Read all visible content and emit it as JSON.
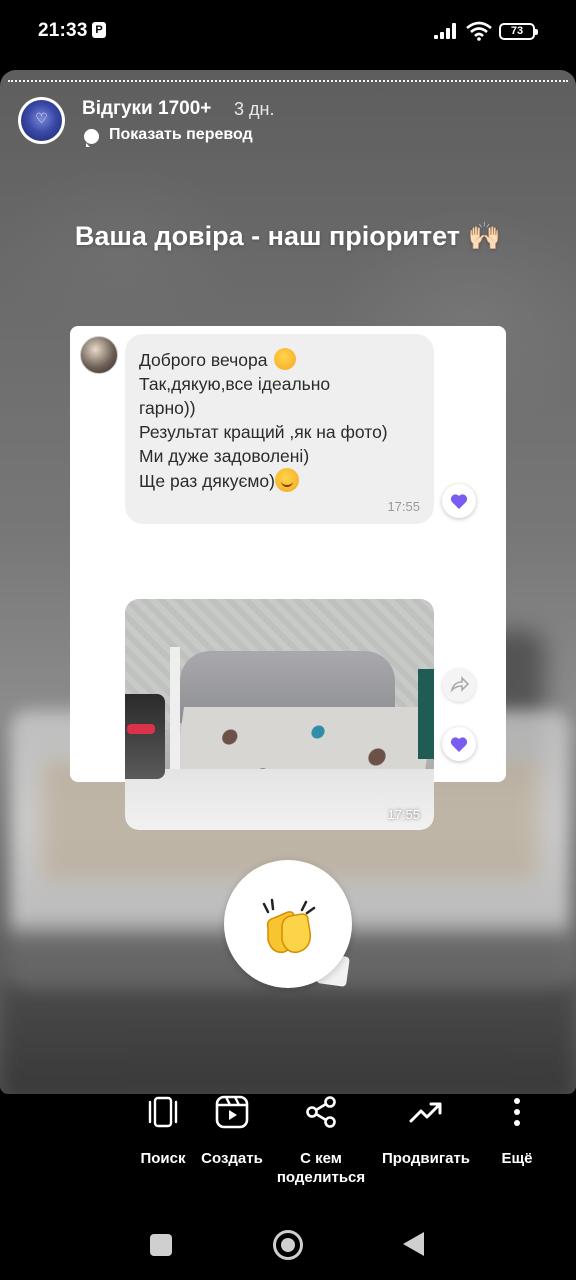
{
  "status_bar": {
    "time": "21:33",
    "notification_icon": "P",
    "battery_level": "73"
  },
  "story": {
    "account_name": "Відгуки 1700+",
    "time_ago": "3 дн.",
    "translate_label": "Показать перевод",
    "heading": "Ваша довіра - наш пріоритет 🙌🏻",
    "chat": {
      "message_lines": [
        "Доброго вечора",
        "Так,дякую,все ідеально",
        "гарно))",
        "Результат кращий ,як на фото)",
        "Ми дуже задоволені)",
        "Ще раз дякуємо)"
      ],
      "message_time": "17:55",
      "photo_time": "17:55",
      "reaction_color": "#7b5cf0"
    },
    "sticker": "clapping-hands"
  },
  "actions": [
    {
      "label": "Поиск",
      "icon": "search-icon"
    },
    {
      "label": "Создать",
      "icon": "create-reel-icon"
    },
    {
      "label": "С кем поделиться",
      "icon": "share-icon"
    },
    {
      "label": "Продвигать",
      "icon": "promote-trend-icon"
    },
    {
      "label": "Ещё",
      "icon": "more-vertical-icon"
    }
  ]
}
